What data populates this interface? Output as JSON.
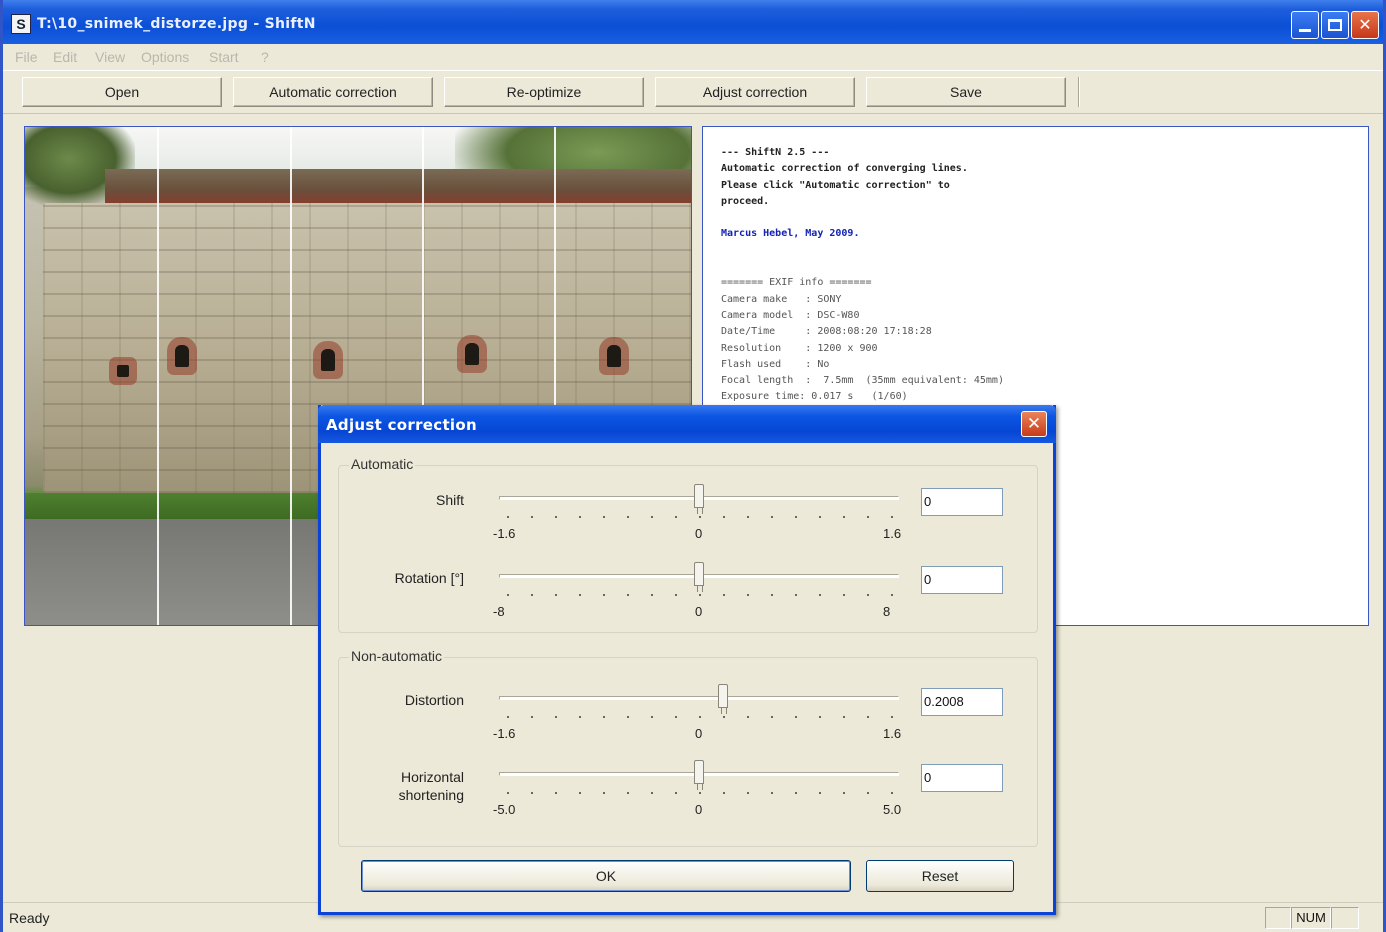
{
  "window": {
    "title": "T:\\10_snimek_distorze.jpg - ShiftN",
    "icon_letter": "S",
    "controls": {
      "minimize": "minimize-icon",
      "maximize": "maximize-icon",
      "close": "✕"
    }
  },
  "menu": [
    "File",
    "Edit",
    "View",
    "Options",
    "Start",
    "?"
  ],
  "toolbar": {
    "open": "Open",
    "automatic_correction": "Automatic correction",
    "re_optimize": "Re-optimize",
    "adjust_correction": "Adjust correction",
    "save": "Save"
  },
  "info_panel": {
    "lines": [
      {
        "text": "--- ShiftN 2.5 ---",
        "style": "bold"
      },
      {
        "text": "Automatic correction of converging lines.",
        "style": "bold"
      },
      {
        "text": "Please click \"Automatic correction\" to",
        "style": "bold"
      },
      {
        "text": "proceed.",
        "style": "bold"
      },
      {
        "text": "",
        "style": "normal"
      },
      {
        "text": "Marcus Hebel, May 2009.",
        "style": "blue"
      },
      {
        "text": "",
        "style": "normal"
      },
      {
        "text": "",
        "style": "normal"
      },
      {
        "text": "======= EXIF info =======",
        "style": "dim"
      },
      {
        "text": "Camera make   : SONY",
        "style": "dim"
      },
      {
        "text": "Camera model  : DSC-W80",
        "style": "dim"
      },
      {
        "text": "Date/Time     : 2008:08:20 17:18:28",
        "style": "dim"
      },
      {
        "text": "Resolution    : 1200 x 900",
        "style": "dim"
      },
      {
        "text": "Flash used    : No",
        "style": "dim"
      },
      {
        "text": "Focal length  :  7.5mm  (35mm equivalent: 45mm)",
        "style": "dim"
      },
      {
        "text": "Exposure time: 0.017 s   (1/60)",
        "style": "dim"
      }
    ]
  },
  "statusbar": {
    "text": "Ready",
    "num": "NUM"
  },
  "dialog": {
    "title": "Adjust correction",
    "close": "✕",
    "groups": {
      "automatic": {
        "label": "Automatic",
        "controls": [
          {
            "label": "Shift",
            "min": "-1.6",
            "mid": "0",
            "max": "1.6",
            "value": "0",
            "position": 0.0,
            "range": [
              -1.6,
              1.6
            ]
          },
          {
            "label": "Rotation [°]",
            "min": "-8",
            "mid": "0",
            "max": "8",
            "value": "0",
            "position": 0.0,
            "range": [
              -8,
              8
            ]
          }
        ]
      },
      "non_automatic": {
        "label": "Non-automatic",
        "controls": [
          {
            "label": "Distortion",
            "min": "-1.6",
            "mid": "0",
            "max": "1.6",
            "value": "0.2008",
            "position": 0.2008,
            "range": [
              -1.6,
              1.6
            ]
          },
          {
            "label": "Horizontal shortening",
            "min": "-5.0",
            "mid": "0",
            "max": "5.0",
            "value": "0",
            "position": 0.0,
            "range": [
              -5.0,
              5.0
            ]
          }
        ]
      }
    },
    "ok": "OK",
    "reset": "Reset"
  },
  "colors": {
    "titlebar": "#0b4fd6",
    "face": "#ece9d8",
    "accent_border": "#3a56c6",
    "blue_text": "#1522b5"
  }
}
